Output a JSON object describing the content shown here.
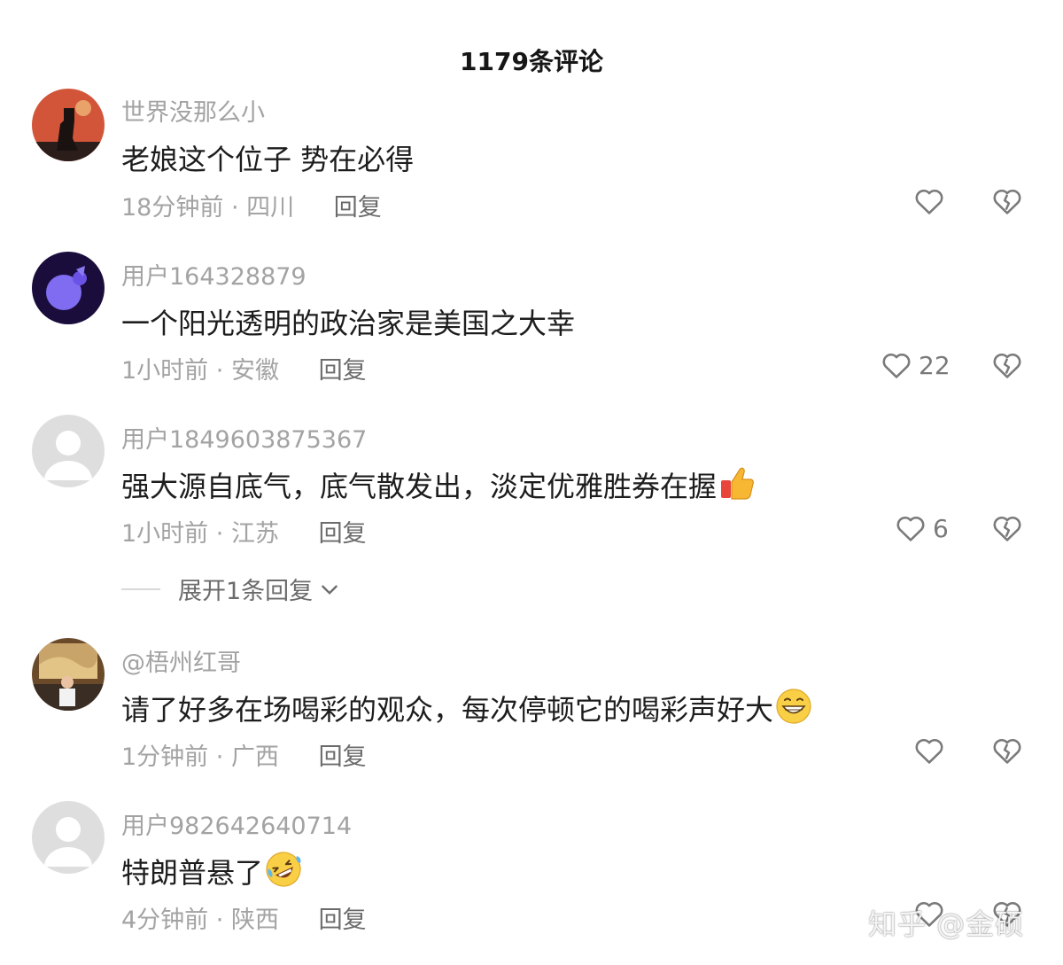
{
  "header": {
    "title": "1179条评论"
  },
  "comments": [
    {
      "username": "世界没那么小",
      "text": "老娘这个位子 势在必得",
      "time": "18分钟前",
      "location": "四川",
      "reply_label": "回复",
      "likes": ""
    },
    {
      "username": "用户164328879",
      "text": "一个阳光透明的政治家是美国之大幸",
      "time": "1小时前",
      "location": "安徽",
      "reply_label": "回复",
      "likes": "22"
    },
    {
      "username": "用户1849603875367",
      "text": "强大源自底气，底气散发出，淡定优雅胜券在握",
      "emoji": "thumbs-up-icon",
      "time": "1小时前",
      "location": "江苏",
      "reply_label": "回复",
      "likes": "6",
      "expand_label": "展开1条回复"
    },
    {
      "username": "@梧州红哥",
      "text": "请了好多在场喝彩的观众，每次停顿它的喝彩声好大",
      "emoji": "grinning-face-icon",
      "time": "1分钟前",
      "location": "广西",
      "reply_label": "回复",
      "likes": ""
    },
    {
      "username": "用户982642640714",
      "text": "特朗普悬了",
      "emoji": "rolling-laughing-face-icon",
      "time": "4分钟前",
      "location": "陕西",
      "reply_label": "回复",
      "likes": ""
    }
  ],
  "separator": "·",
  "watermark": "知乎 @金硕",
  "colors": {
    "muted": "#a3a3a3",
    "text": "#1d1d1d",
    "icon": "#7a7a7a"
  }
}
